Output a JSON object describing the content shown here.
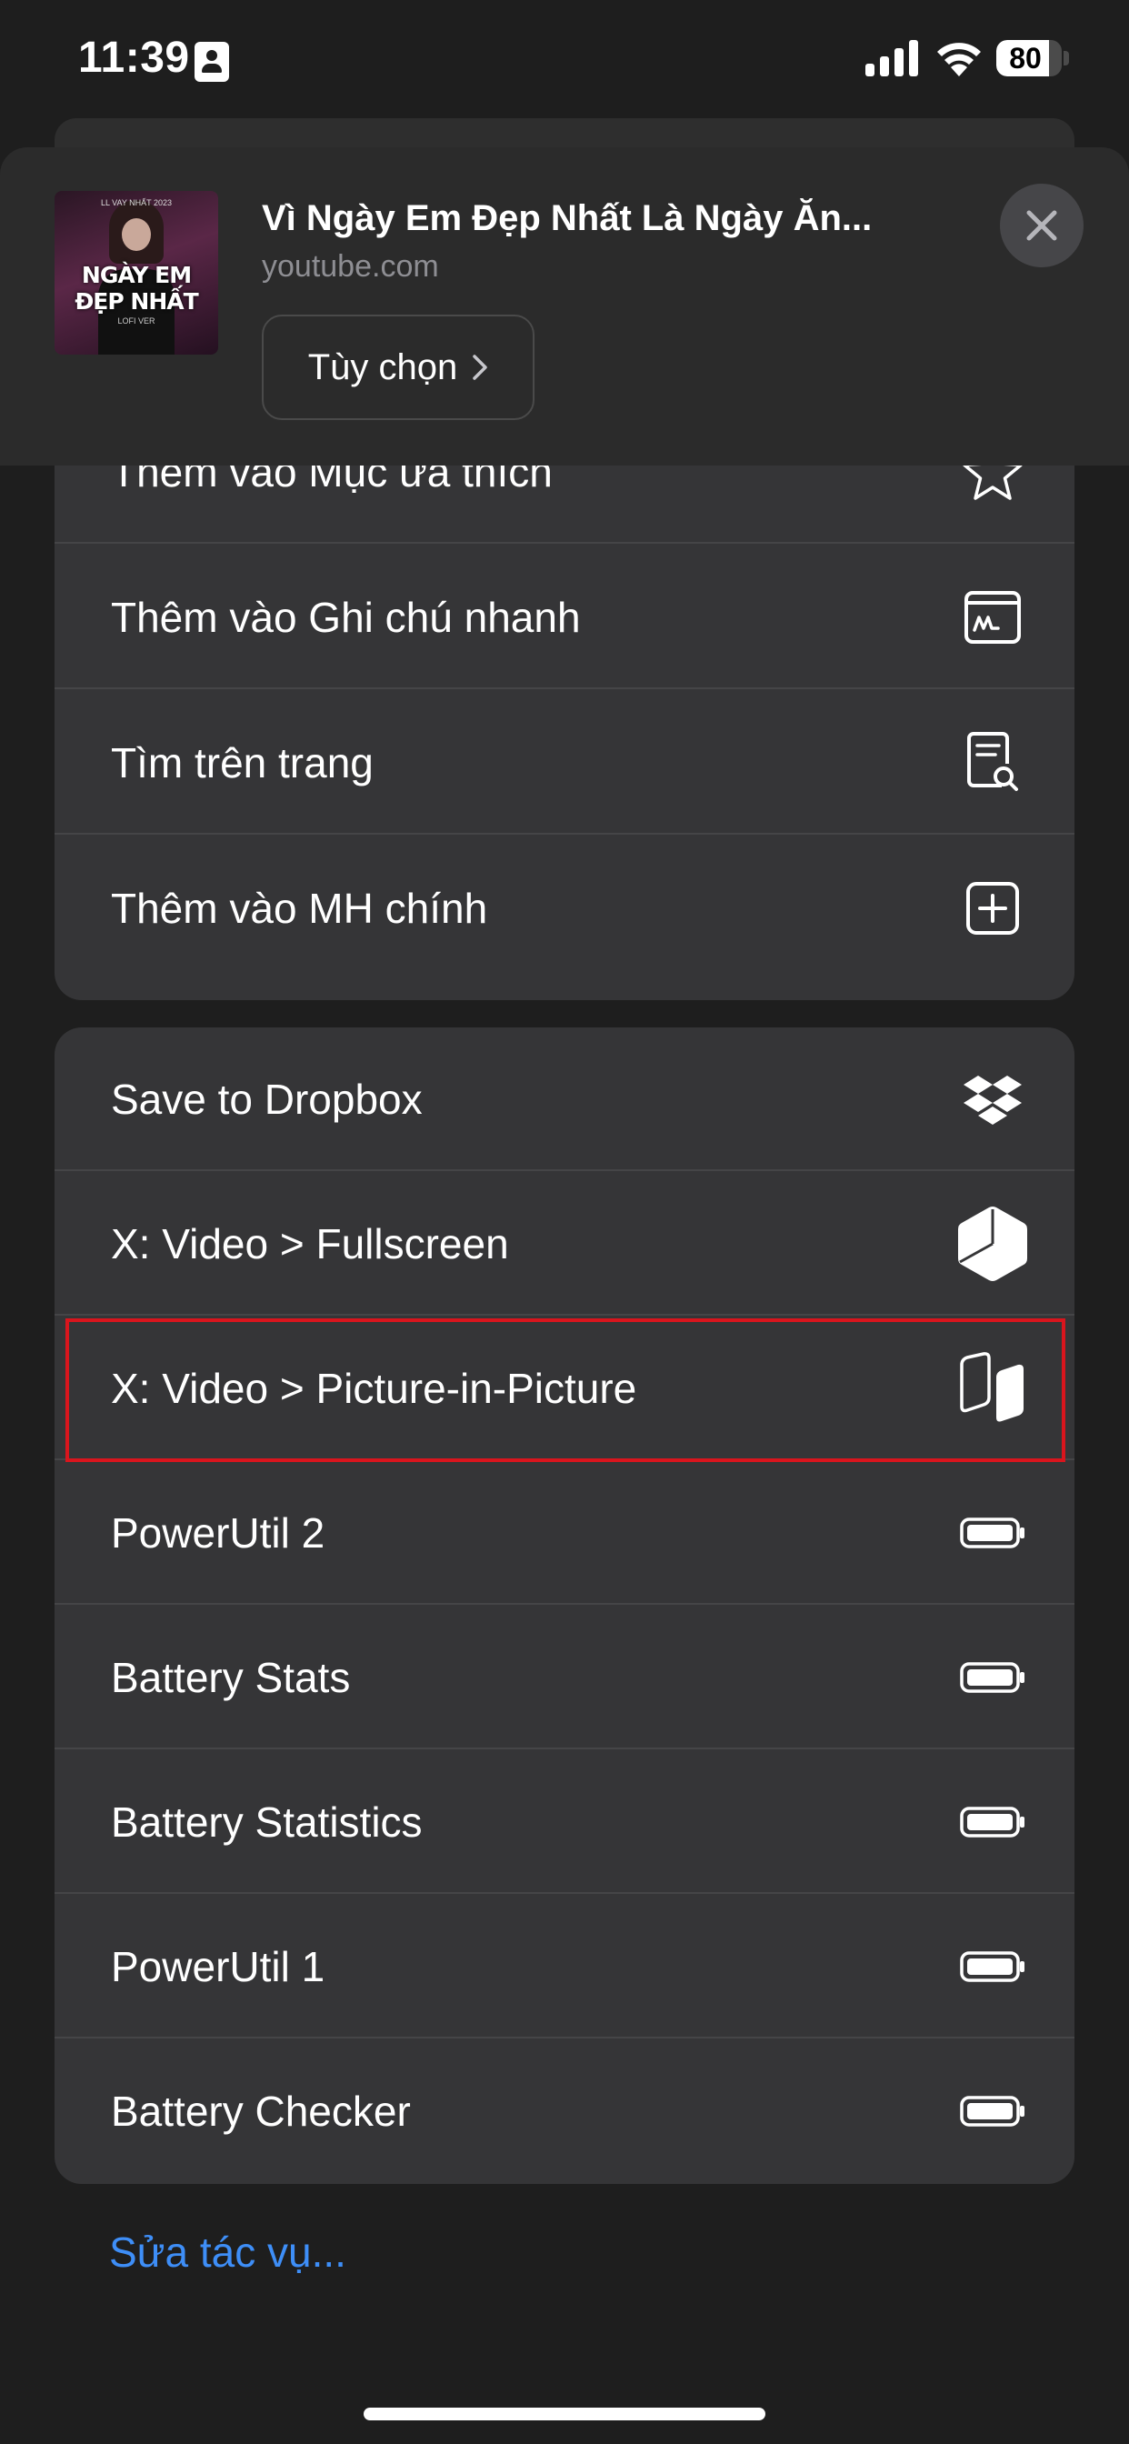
{
  "status_bar": {
    "time": "11:39",
    "battery_level": "80",
    "battery_fraction": 0.8
  },
  "share_header": {
    "title": "Vì Ngày Em Đẹp Nhất Là Ngày Ăn...",
    "domain": "youtube.com",
    "options_label": "Tùy chọn",
    "thumbnail": {
      "top_text": "LL VAY NHẤT 2023",
      "main_text": "NGÀY EM ĐẸP NHẤT",
      "bottom_text": "LOFI VER"
    }
  },
  "menu_group_1": {
    "items": [
      {
        "label": "Thêm vào Mục ưa thích",
        "icon": "star-icon"
      },
      {
        "label": "Thêm vào Ghi chú nhanh",
        "icon": "quick-note-icon"
      },
      {
        "label": "Tìm trên trang",
        "icon": "find-on-page-icon"
      },
      {
        "label": "Thêm vào MH chính",
        "icon": "add-square-icon"
      }
    ]
  },
  "menu_group_2": {
    "items": [
      {
        "label": "Save to Dropbox",
        "icon": "dropbox-icon"
      },
      {
        "label": "X: Video > Fullscreen",
        "icon": "fullscreen-cube-icon"
      },
      {
        "label": "X: Video > Picture-in-Picture",
        "icon": "pip-shapes-icon"
      },
      {
        "label": "PowerUtil 2",
        "icon": "battery-icon"
      },
      {
        "label": "Battery Stats",
        "icon": "battery-icon"
      },
      {
        "label": "Battery Statistics",
        "icon": "battery-icon"
      },
      {
        "label": "PowerUtil 1",
        "icon": "battery-icon"
      },
      {
        "label": "Battery Checker",
        "icon": "battery-icon"
      }
    ]
  },
  "edit_actions_label": "Sửa tác vụ...",
  "colors": {
    "background": "#1e1e1e",
    "group_background": "#353537",
    "link_blue": "#3e8ef7",
    "highlight_red": "#d9151d"
  }
}
